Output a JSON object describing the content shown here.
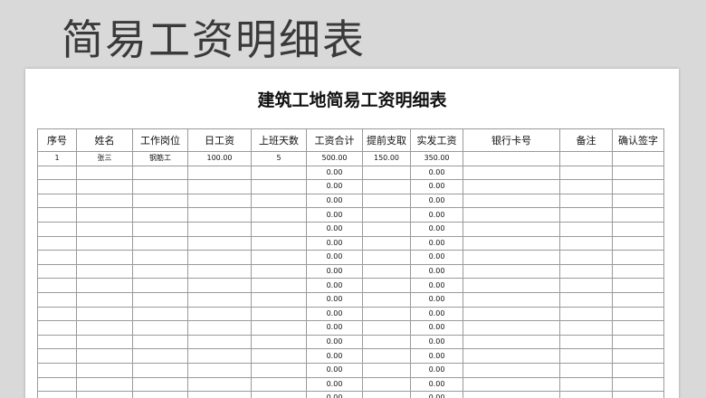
{
  "banner": {
    "title": "简易工资明细表"
  },
  "sheet": {
    "title": "建筑工地简易工资明细表",
    "columns": [
      "序号",
      "姓名",
      "工作岗位",
      "日工资",
      "上班天数",
      "工资合计",
      "提前支取",
      "实发工资",
      "银行卡号",
      "备注",
      "确认签字"
    ],
    "rows": [
      [
        "1",
        "张三",
        "钢筋工",
        "100.00",
        "5",
        "500.00",
        "150.00",
        "350.00",
        "",
        "",
        ""
      ],
      [
        "",
        "",
        "",
        "",
        "",
        "0.00",
        "",
        "0.00",
        "",
        "",
        ""
      ],
      [
        "",
        "",
        "",
        "",
        "",
        "0.00",
        "",
        "0.00",
        "",
        "",
        ""
      ],
      [
        "",
        "",
        "",
        "",
        "",
        "0.00",
        "",
        "0.00",
        "",
        "",
        ""
      ],
      [
        "",
        "",
        "",
        "",
        "",
        "0.00",
        "",
        "0.00",
        "",
        "",
        ""
      ],
      [
        "",
        "",
        "",
        "",
        "",
        "0.00",
        "",
        "0.00",
        "",
        "",
        ""
      ],
      [
        "",
        "",
        "",
        "",
        "",
        "0.00",
        "",
        "0.00",
        "",
        "",
        ""
      ],
      [
        "",
        "",
        "",
        "",
        "",
        "0.00",
        "",
        "0.00",
        "",
        "",
        ""
      ],
      [
        "",
        "",
        "",
        "",
        "",
        "0.00",
        "",
        "0.00",
        "",
        "",
        ""
      ],
      [
        "",
        "",
        "",
        "",
        "",
        "0.00",
        "",
        "0.00",
        "",
        "",
        ""
      ],
      [
        "",
        "",
        "",
        "",
        "",
        "0.00",
        "",
        "0.00",
        "",
        "",
        ""
      ],
      [
        "",
        "",
        "",
        "",
        "",
        "0.00",
        "",
        "0.00",
        "",
        "",
        ""
      ],
      [
        "",
        "",
        "",
        "",
        "",
        "0.00",
        "",
        "0.00",
        "",
        "",
        ""
      ],
      [
        "",
        "",
        "",
        "",
        "",
        "0.00",
        "",
        "0.00",
        "",
        "",
        ""
      ],
      [
        "",
        "",
        "",
        "",
        "",
        "0.00",
        "",
        "0.00",
        "",
        "",
        ""
      ],
      [
        "",
        "",
        "",
        "",
        "",
        "0.00",
        "",
        "0.00",
        "",
        "",
        ""
      ],
      [
        "",
        "",
        "",
        "",
        "",
        "0.00",
        "",
        "0.00",
        "",
        "",
        ""
      ],
      [
        "",
        "",
        "",
        "",
        "",
        "0.00",
        "",
        "0.00",
        "",
        "",
        ""
      ]
    ]
  }
}
